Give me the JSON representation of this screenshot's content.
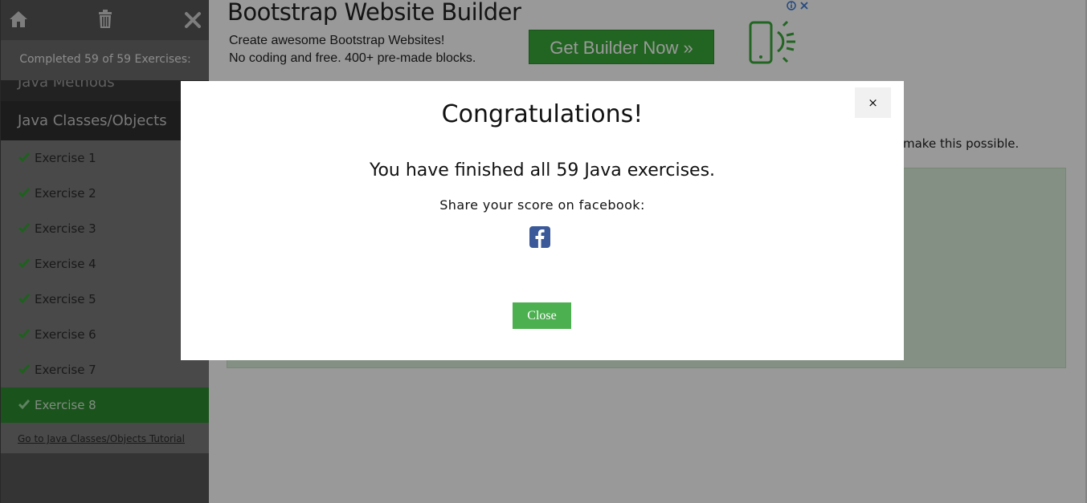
{
  "sidebar": {
    "progress_text": "Completed 59 of 59 Exercises:",
    "prev_chapter": "Java Methods",
    "current_chapter": "Java Classes/Objects",
    "exercises": [
      {
        "label": "Exercise 1"
      },
      {
        "label": "Exercise 2"
      },
      {
        "label": "Exercise 3"
      },
      {
        "label": "Exercise 4"
      },
      {
        "label": "Exercise 5"
      },
      {
        "label": "Exercise 6"
      },
      {
        "label": "Exercise 7"
      },
      {
        "label": "Exercise 8"
      }
    ],
    "active_exercise": "Exercise 8",
    "tutorial_link": "Go to Java Classes/Objects Tutorial"
  },
  "ad": {
    "title": "Bootstrap Website Builder",
    "line1": "Create awesome Bootstrap Websites!",
    "line2": "No coding and free. 400+ pre-made blocks.",
    "button": "Get Builder Now »"
  },
  "main": {
    "partial_text": "make this possible."
  },
  "modal": {
    "close_x": "×",
    "title": "Congratulations!",
    "message": "You have finished all 59 Java exercises.",
    "share_text": "Share your score on facebook:",
    "close_button": "Close"
  },
  "colors": {
    "accent_green": "#4caf50",
    "active_item": "#2c8a30",
    "facebook_blue": "#3b5998"
  },
  "icons": [
    "home-icon",
    "trash-icon",
    "close-icon",
    "checkmark-icon",
    "facebook-icon",
    "phone-icon",
    "adchoices-icon"
  ]
}
